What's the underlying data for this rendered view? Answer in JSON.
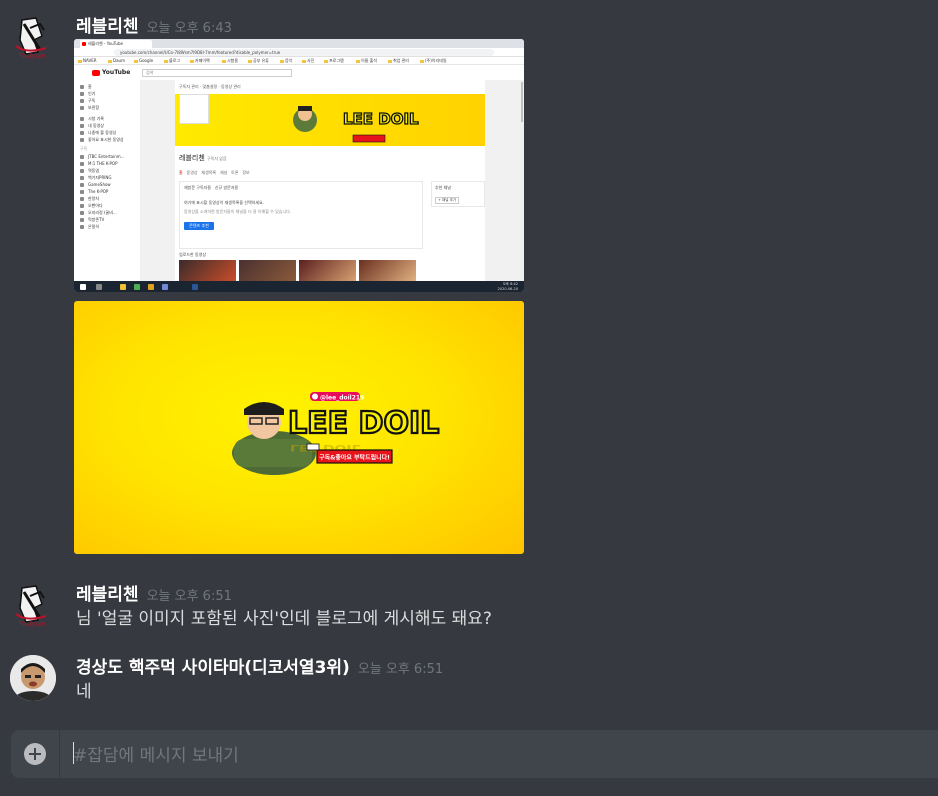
{
  "messages": [
    {
      "author": "레블리첸",
      "timestamp": "오늘 오후 6:43",
      "attachments": [
        "browser-screenshot",
        "channel-banner-image"
      ]
    },
    {
      "author": "레블리첸",
      "timestamp": "오늘 오후 6:51",
      "text": "님 '얼굴 이미지 포함된 사진'인데 블로그에 게시해도 돼요?"
    },
    {
      "author": "경상도 핵주먹 사이타마(디코서열3위)",
      "timestamp": "오늘 오후 6:51",
      "text": "네"
    }
  ],
  "composer": {
    "placeholder": "#잡담에 메시지 보내기"
  },
  "screenshot": {
    "tab_title": "레블리첸 - YouTube",
    "url": "youtube.com/channel/UCo-7I8Wsm7I9D8l-7mm/featured?disable_polymer=true",
    "bookmarks": [
      "NAVER",
      "Daum",
      "Google",
      "블로그",
      "카페이팩",
      "시험용",
      "공부 유튜",
      "음악",
      "사진",
      "프로그램",
      "이름 출석",
      "취업 관리",
      "(주)이리데일"
    ],
    "search_placeholder": "검색",
    "youtube_logo": "YouTube",
    "sidebar_items": [
      "홈",
      "인기",
      "구독",
      "보관함",
      "시청 기록",
      "내 동영상",
      "나중에 볼 동영상",
      "좋아요 표시한 동영상"
    ],
    "sidebar_heading_subs": "구독",
    "subscriptions": [
      "JTBC Entertainm...",
      "M:1 THE K-POP",
      "역동엽",
      "백가지PRING",
      "GameShow",
      "The K-POP",
      "한량차",
      "오빤아다",
      "오지리정 (꿀비...",
      "먹방존TV",
      "은밀히"
    ],
    "channel_top": "구독자 관리 · 맞춤설정 · 동영상 관리",
    "channel_name": "레블리첸",
    "channel_subs": "구독자 없음",
    "channel_tabs": [
      "홈",
      "동영상",
      "재생목록",
      "채널",
      "토론",
      "정보"
    ],
    "box_tabs": [
      "재방문 구독자용",
      "신규 방문자용"
    ],
    "box_text_1": "여기에 표시할 동영상이 재생목록을 선택하세요.",
    "box_text_2": "동영상을 소개하면 방문자들이 채널을 더 잘 이해할 수 있습니다.",
    "box_button": "콘텐츠 추천",
    "side_title": "추천 채널",
    "side_button": "+ 채널 추가",
    "uploads_label": "업로드한 동영상",
    "taskbar_time": "오후 6:42",
    "taskbar_date": "2020-06-20"
  },
  "banner": {
    "logo_text": "LEE DOIL",
    "handle": "@lee_doil219",
    "subscribe_text": "구독&좋아요 부탁드립니다!"
  }
}
